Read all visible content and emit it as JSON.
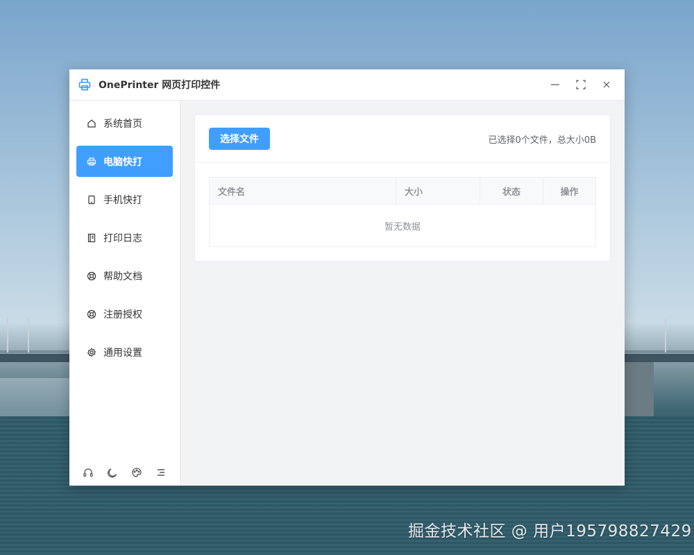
{
  "window": {
    "title": "OnePrinter 网页打印控件",
    "accent": "#409eff"
  },
  "titlebar_buttons": [
    "minimize-icon",
    "maximize-icon",
    "close-icon"
  ],
  "sidebar": {
    "items": [
      {
        "label": "系统首页",
        "icon": "home-icon"
      },
      {
        "label": "电脑快打",
        "icon": "printer-icon",
        "active": true
      },
      {
        "label": "手机快打",
        "icon": "phone-icon"
      },
      {
        "label": "打印日志",
        "icon": "log-icon"
      },
      {
        "label": "帮助文档",
        "icon": "help-icon"
      },
      {
        "label": "注册授权",
        "icon": "license-icon"
      },
      {
        "label": "通用设置",
        "icon": "settings-icon"
      }
    ],
    "footer_icons": [
      "headset-icon",
      "moon-icon",
      "palette-icon",
      "menu-icon"
    ]
  },
  "main": {
    "select_button": "选择文件",
    "summary": "已选择0个文件，总大小0B",
    "table": {
      "columns": [
        "文件名",
        "大小",
        "状态",
        "操作"
      ],
      "empty_text": "暂无数据"
    }
  },
  "watermark": "掘金技术社区 @ 用户195798827429"
}
